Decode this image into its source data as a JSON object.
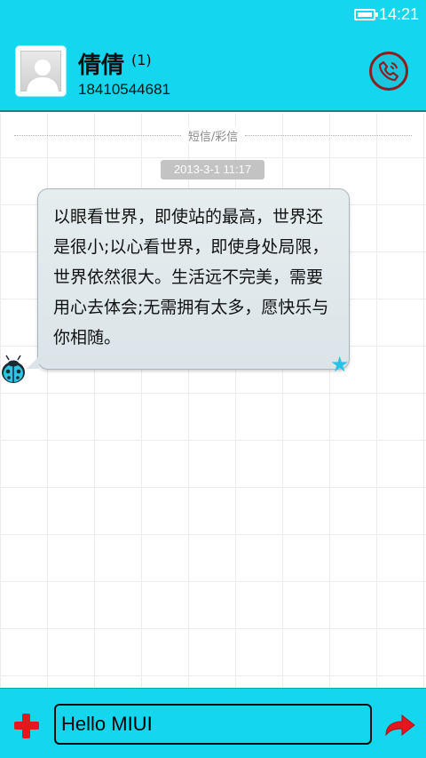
{
  "status_bar": {
    "time": "14:21",
    "battery_icon": "battery-full-icon"
  },
  "header": {
    "contact_name": "倩倩",
    "unread_count": "(1)",
    "phone_number": "18410544681",
    "avatar_icon": "default-avatar-icon",
    "call_icon": "phone-call-icon"
  },
  "conversation": {
    "type_label": "短信/彩信",
    "timestamp": "2013-3-1 11:17",
    "messages": [
      {
        "direction": "incoming",
        "text": "以眼看世界，即使站的最高，世界还是很小;以心看世界，即使身处局限，世界依然很大。生活远不完美，需要用心去体会;无需拥有太多，愿快乐与你相随。",
        "sender_icon": "ladybug-icon",
        "status_icon": "star-icon"
      }
    ]
  },
  "input_bar": {
    "add_icon": "plus-icon",
    "message_value": "Hello MIUI",
    "send_icon": "send-arrow-icon"
  },
  "colors": {
    "accent": "#14d6ee",
    "accent_dark": "#1b7f94",
    "danger": "#e5161d",
    "bubble": "#dbe4e8",
    "star": "#27c3e6"
  }
}
